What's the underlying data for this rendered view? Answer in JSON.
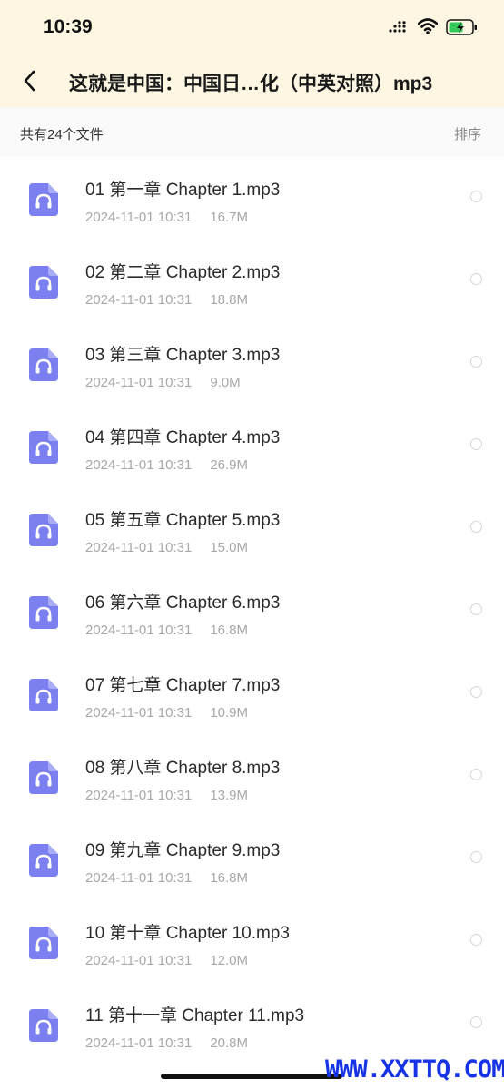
{
  "status_bar": {
    "time": "10:39"
  },
  "nav": {
    "title": "这就是中国：中国日…化（中英对照）mp3"
  },
  "subbar": {
    "count_label": "共有24个文件",
    "sort_label": "排序"
  },
  "files": [
    {
      "name": "01 第一章 Chapter 1.mp3",
      "date": "2024-11-01 10:31",
      "size": "16.7M"
    },
    {
      "name": "02 第二章 Chapter 2.mp3",
      "date": "2024-11-01 10:31",
      "size": "18.8M"
    },
    {
      "name": "03 第三章 Chapter 3.mp3",
      "date": "2024-11-01 10:31",
      "size": "9.0M"
    },
    {
      "name": "04 第四章 Chapter 4.mp3",
      "date": "2024-11-01 10:31",
      "size": "26.9M"
    },
    {
      "name": "05 第五章 Chapter 5.mp3",
      "date": "2024-11-01 10:31",
      "size": "15.0M"
    },
    {
      "name": "06 第六章 Chapter 6.mp3",
      "date": "2024-11-01 10:31",
      "size": "16.8M"
    },
    {
      "name": "07 第七章 Chapter 7.mp3",
      "date": "2024-11-01 10:31",
      "size": "10.9M"
    },
    {
      "name": "08 第八章 Chapter 8.mp3",
      "date": "2024-11-01 10:31",
      "size": "13.9M"
    },
    {
      "name": "09 第九章 Chapter 9.mp3",
      "date": "2024-11-01 10:31",
      "size": "16.8M"
    },
    {
      "name": "10 第十章 Chapter 10.mp3",
      "date": "2024-11-01 10:31",
      "size": "12.0M"
    },
    {
      "name": "11 第十一章 Chapter 11.mp3",
      "date": "2024-11-01 10:31",
      "size": "20.8M"
    }
  ],
  "watermark": "WWW.XXTTQ.COM",
  "colors": {
    "header_bg": "#fdf6e3",
    "file_icon": "#7b7ff0",
    "battery": "#34c759",
    "watermark": "#1634e6"
  },
  "icons": {
    "file": "audio-file-icon",
    "back": "chevron-left-icon"
  }
}
